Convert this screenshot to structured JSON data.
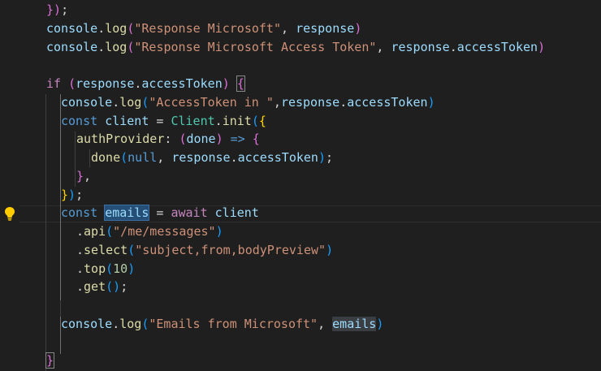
{
  "editor": {
    "lightbulb_icon": "lightbulb-icon",
    "colors": {
      "background": "#1f1f1f",
      "function": "#dcdcaa",
      "variable": "#9cdcfe",
      "string": "#ce9178",
      "keyword": "#569cd6",
      "control": "#c586c0",
      "class": "#4ec9b0",
      "number": "#b5cea8",
      "bracket_level1": "#ffd700",
      "bracket_level2": "#da70d6",
      "bracket_level3": "#179fff",
      "selection": "#264f78"
    },
    "lines": [
      [
        [
          "t-b2",
          "})"
        ],
        [
          "t-punc",
          ";"
        ]
      ],
      [
        [
          "t-var",
          "console"
        ],
        [
          "t-punc",
          "."
        ],
        [
          "t-func",
          "log"
        ],
        [
          "t-b2",
          "("
        ],
        [
          "t-str",
          "\"Response Microsoft\""
        ],
        [
          "t-punc",
          ", "
        ],
        [
          "t-var",
          "response"
        ],
        [
          "t-b2",
          ")"
        ]
      ],
      [
        [
          "t-var",
          "console"
        ],
        [
          "t-punc",
          "."
        ],
        [
          "t-func",
          "log"
        ],
        [
          "t-b2",
          "("
        ],
        [
          "t-str",
          "\"Response Microsoft Access Token\""
        ],
        [
          "t-punc",
          ", "
        ],
        [
          "t-var",
          "response"
        ],
        [
          "t-punc",
          "."
        ],
        [
          "t-var",
          "accessToken"
        ],
        [
          "t-b2",
          ")"
        ]
      ],
      [],
      [
        [
          "t-ctrl",
          "if"
        ],
        [
          "t-punc",
          " "
        ],
        [
          "t-b2",
          "("
        ],
        [
          "t-var",
          "response"
        ],
        [
          "t-punc",
          "."
        ],
        [
          "t-var",
          "accessToken"
        ],
        [
          "t-b2",
          ")"
        ],
        [
          "t-punc",
          " "
        ],
        [
          "t-b2 bracket-match",
          "{"
        ]
      ],
      [
        [
          "t-var",
          "console"
        ],
        [
          "t-punc",
          "."
        ],
        [
          "t-func",
          "log"
        ],
        [
          "t-b3",
          "("
        ],
        [
          "t-str",
          "\"AccessToken in \""
        ],
        [
          "t-punc",
          ","
        ],
        [
          "t-var",
          "response"
        ],
        [
          "t-punc",
          "."
        ],
        [
          "t-var",
          "accessToken"
        ],
        [
          "t-b3",
          ")"
        ]
      ],
      [
        [
          "t-kw",
          "const"
        ],
        [
          "t-punc",
          " "
        ],
        [
          "t-var",
          "client"
        ],
        [
          "t-punc",
          " = "
        ],
        [
          "t-class",
          "Client"
        ],
        [
          "t-punc",
          "."
        ],
        [
          "t-func",
          "init"
        ],
        [
          "t-b3",
          "("
        ],
        [
          "t-b1",
          "{"
        ]
      ],
      [
        [
          "t-func",
          "authProvider"
        ],
        [
          "t-punc",
          ": "
        ],
        [
          "t-b2",
          "("
        ],
        [
          "t-var",
          "done"
        ],
        [
          "t-b2",
          ")"
        ],
        [
          "t-punc",
          " "
        ],
        [
          "t-kw",
          "=>"
        ],
        [
          "t-punc",
          " "
        ],
        [
          "t-b2",
          "{"
        ]
      ],
      [
        [
          "t-func",
          "done"
        ],
        [
          "t-b3",
          "("
        ],
        [
          "t-kw",
          "null"
        ],
        [
          "t-punc",
          ", "
        ],
        [
          "t-var",
          "response"
        ],
        [
          "t-punc",
          "."
        ],
        [
          "t-var",
          "accessToken"
        ],
        [
          "t-b3",
          ")"
        ],
        [
          "t-punc",
          ";"
        ]
      ],
      [
        [
          "t-b2",
          "}"
        ],
        [
          "t-punc",
          ","
        ]
      ],
      [
        [
          "t-b1",
          "}"
        ],
        [
          "t-b3",
          ")"
        ],
        [
          "t-punc",
          ";"
        ]
      ],
      [
        [
          "t-kw",
          "const"
        ],
        [
          "t-punc",
          " "
        ],
        [
          "cursor",
          ""
        ],
        [
          "t-var hl-sel",
          "emails"
        ],
        [
          "t-punc",
          " = "
        ],
        [
          "t-ctrl",
          "await"
        ],
        [
          "t-punc",
          " "
        ],
        [
          "t-var",
          "client"
        ]
      ],
      [
        [
          "t-punc",
          "."
        ],
        [
          "t-func",
          "api"
        ],
        [
          "t-b3",
          "("
        ],
        [
          "t-str",
          "\"/me/messages\""
        ],
        [
          "t-b3",
          ")"
        ]
      ],
      [
        [
          "t-punc",
          "."
        ],
        [
          "t-func",
          "select"
        ],
        [
          "t-b3",
          "("
        ],
        [
          "t-str",
          "\"subject,from,bodyPreview\""
        ],
        [
          "t-b3",
          ")"
        ]
      ],
      [
        [
          "t-punc",
          "."
        ],
        [
          "t-func",
          "top"
        ],
        [
          "t-b3",
          "("
        ],
        [
          "t-num",
          "10"
        ],
        [
          "t-b3",
          ")"
        ]
      ],
      [
        [
          "t-punc",
          "."
        ],
        [
          "t-func",
          "get"
        ],
        [
          "t-b3",
          "()"
        ],
        [
          "t-punc",
          ";"
        ]
      ],
      [],
      [
        [
          "t-var",
          "console"
        ],
        [
          "t-punc",
          "."
        ],
        [
          "t-func",
          "log"
        ],
        [
          "t-b3",
          "("
        ],
        [
          "t-str",
          "\"Emails from Microsoft\""
        ],
        [
          "t-punc",
          ", "
        ],
        [
          "t-var hl-ref",
          "emails"
        ],
        [
          "t-b3",
          ")"
        ]
      ],
      [],
      [
        [
          "t-b2 bracket-match",
          "}"
        ]
      ]
    ]
  }
}
